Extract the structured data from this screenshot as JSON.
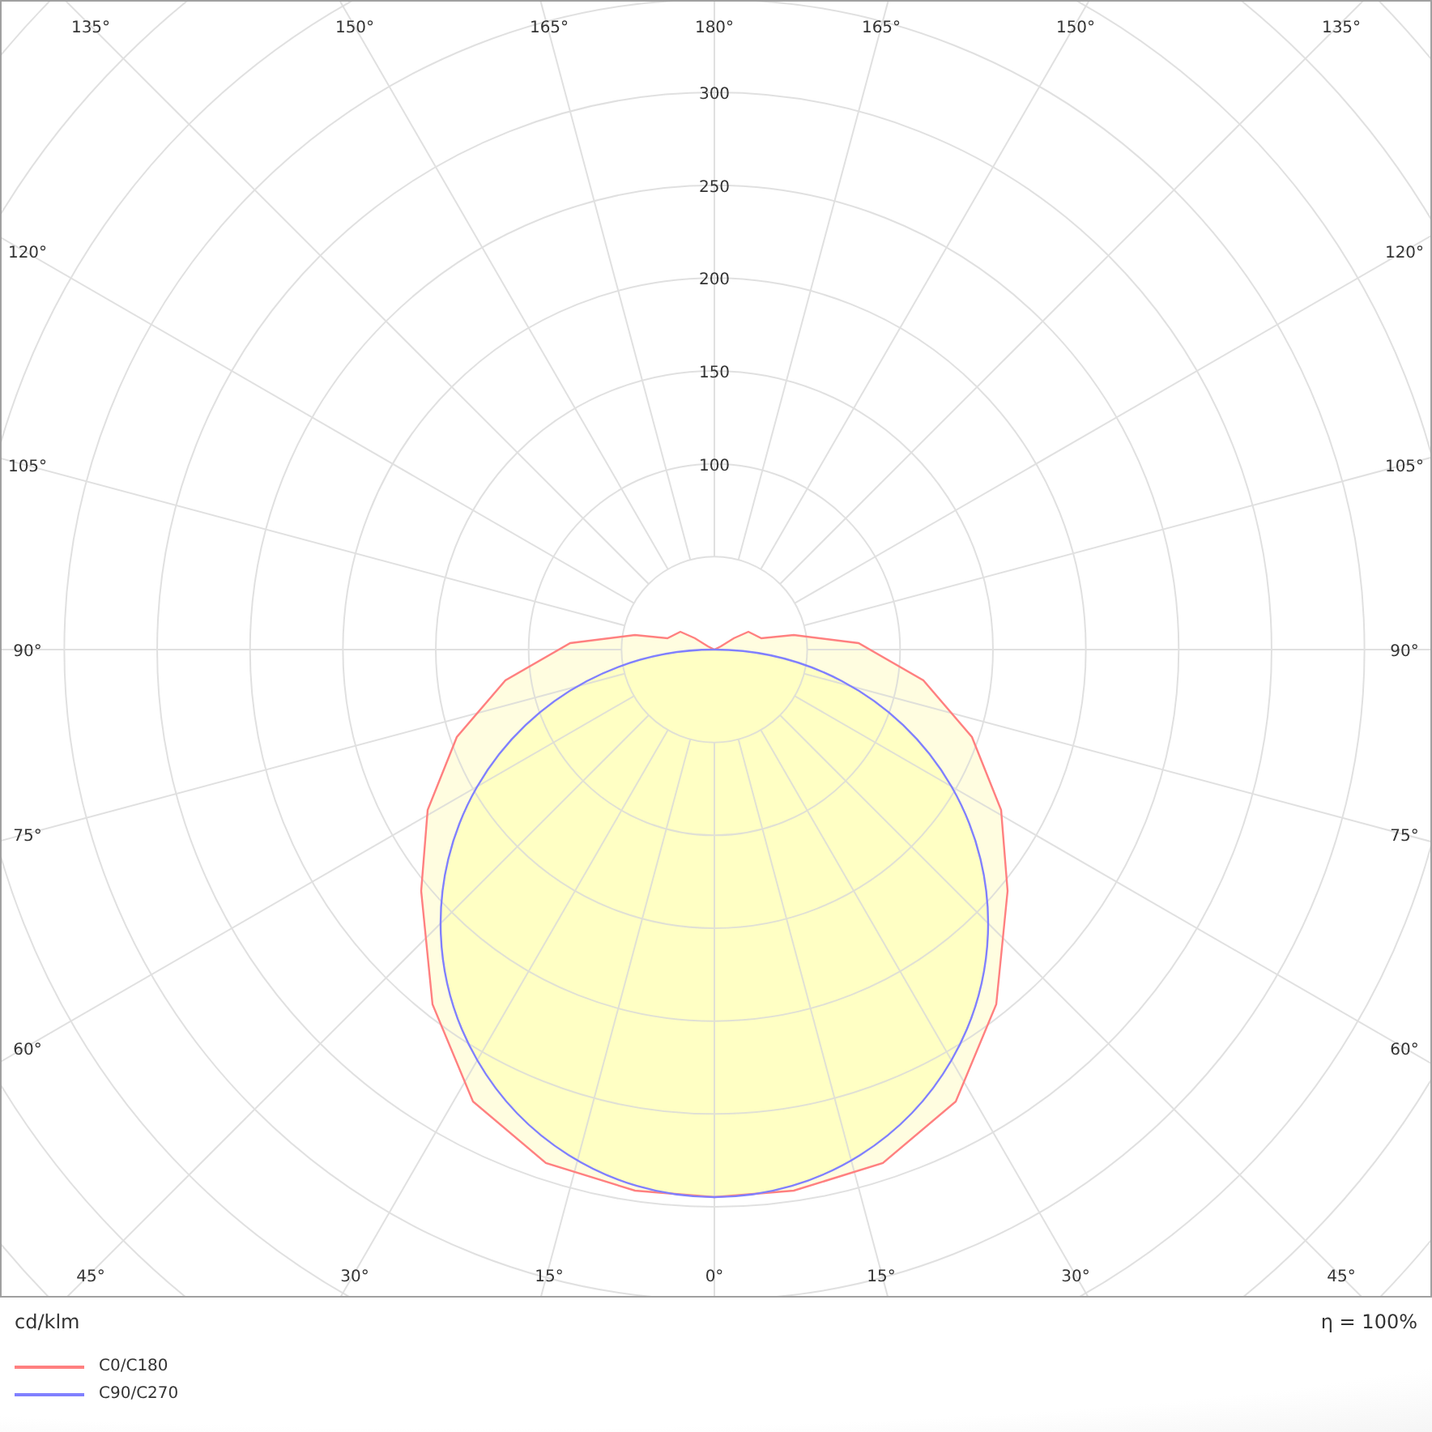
{
  "diagram": {
    "angle_labels": {
      "top": [
        "135°",
        "150°",
        "165°",
        "180°",
        "165°",
        "150°",
        "135°"
      ],
      "left": [
        "120°",
        "105°",
        "90°",
        "75°",
        "60°"
      ],
      "right": [
        "120°",
        "105°",
        "90°",
        "75°",
        "60°"
      ],
      "bottom": [
        "45°",
        "30°",
        "15°",
        "0°",
        "15°",
        "30°",
        "45°"
      ]
    },
    "radial_labels": [
      "300",
      "250",
      "200",
      "150",
      "100"
    ]
  },
  "unit": "cd/klm",
  "efficiency": "η = 100%",
  "legend": [
    {
      "label": "C0/C180",
      "color": "#ff8080"
    },
    {
      "label": "C90/C270",
      "color": "#8080ff"
    }
  ]
}
